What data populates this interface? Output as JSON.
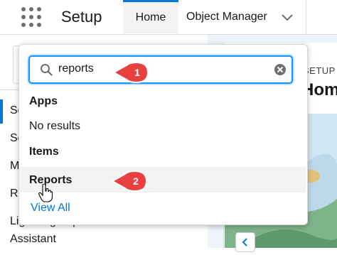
{
  "header": {
    "app_title": "Setup",
    "tabs": [
      {
        "label": "Home",
        "active": true
      },
      {
        "label": "Object Manager",
        "active": false
      }
    ]
  },
  "search": {
    "value": "reports",
    "icon": "search-icon",
    "clear_icon": "clear-icon"
  },
  "dropdown": {
    "apps_header": "Apps",
    "apps_empty": "No results",
    "items_header": "Items",
    "items": [
      {
        "label": "Reports",
        "highlighted": true
      }
    ],
    "view_all": "View All"
  },
  "sidebar": {
    "items": [
      {
        "label": "Se"
      },
      {
        "label": "Se"
      },
      {
        "label": "M"
      },
      {
        "label": "Re"
      },
      {
        "label": "Lightning Experience Transition"
      },
      {
        "label": "Assistant"
      }
    ]
  },
  "main": {
    "breadcrumb": "SETUP",
    "heading": "Hom"
  },
  "annotations": {
    "step1": "1",
    "step2": "2"
  },
  "colors": {
    "accent": "#0176d3",
    "search_focus": "#1b96ff",
    "callout": "#e8403e"
  }
}
